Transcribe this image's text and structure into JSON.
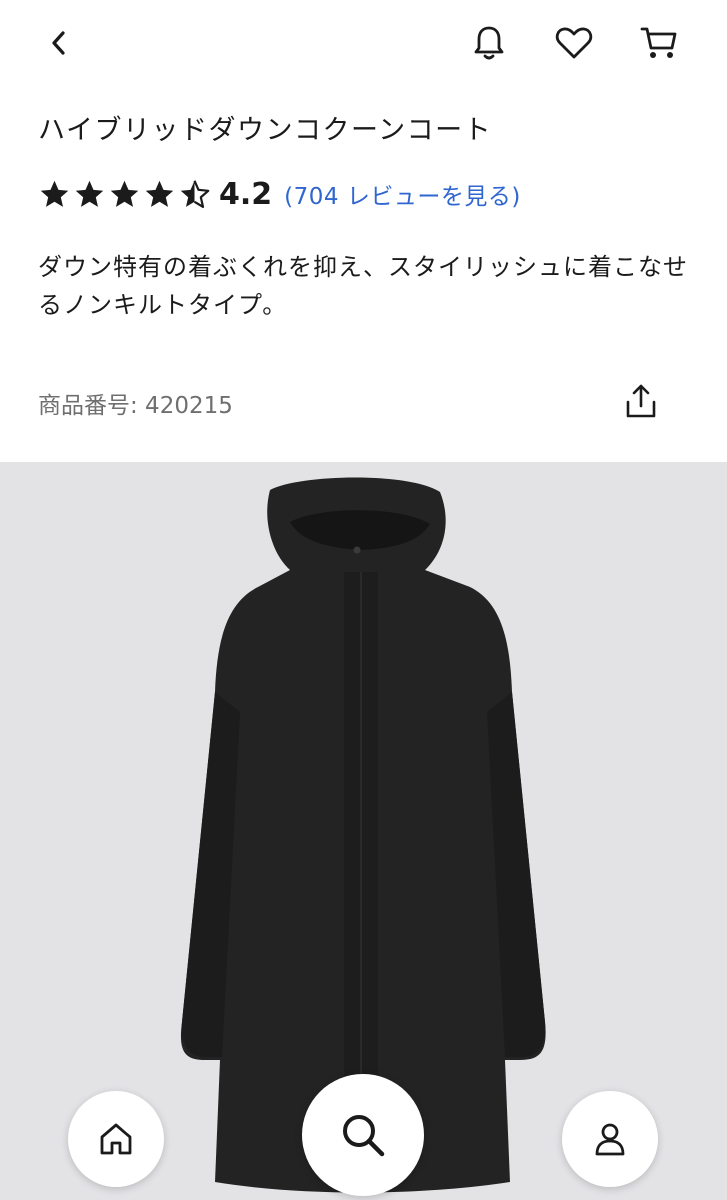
{
  "header": {
    "icons": {
      "back": "chevron-left-icon",
      "bell": "bell-icon",
      "heart": "heart-icon",
      "cart": "cart-icon"
    }
  },
  "product": {
    "title": "ハイブリッドダウンコクーンコート",
    "rating": {
      "stars": 4.5,
      "value": "4.2",
      "reviews_link": "(704 レビューを見る)"
    },
    "description": "ダウン特有の着ぶくれを抑え、スタイリッシュに着こなせるノンキルトタイプ。",
    "product_number": "商品番号: 420215",
    "share_icon": "share-icon"
  },
  "image": {
    "background": "#e3e3e6",
    "coat_color": "#232323"
  },
  "bottom_nav": {
    "icons": {
      "home": "home-icon",
      "search": "search-icon",
      "account": "user-icon"
    }
  },
  "colors": {
    "text": "#1b1b1b",
    "link": "#2f66d0",
    "muted": "#6f6f6f"
  }
}
